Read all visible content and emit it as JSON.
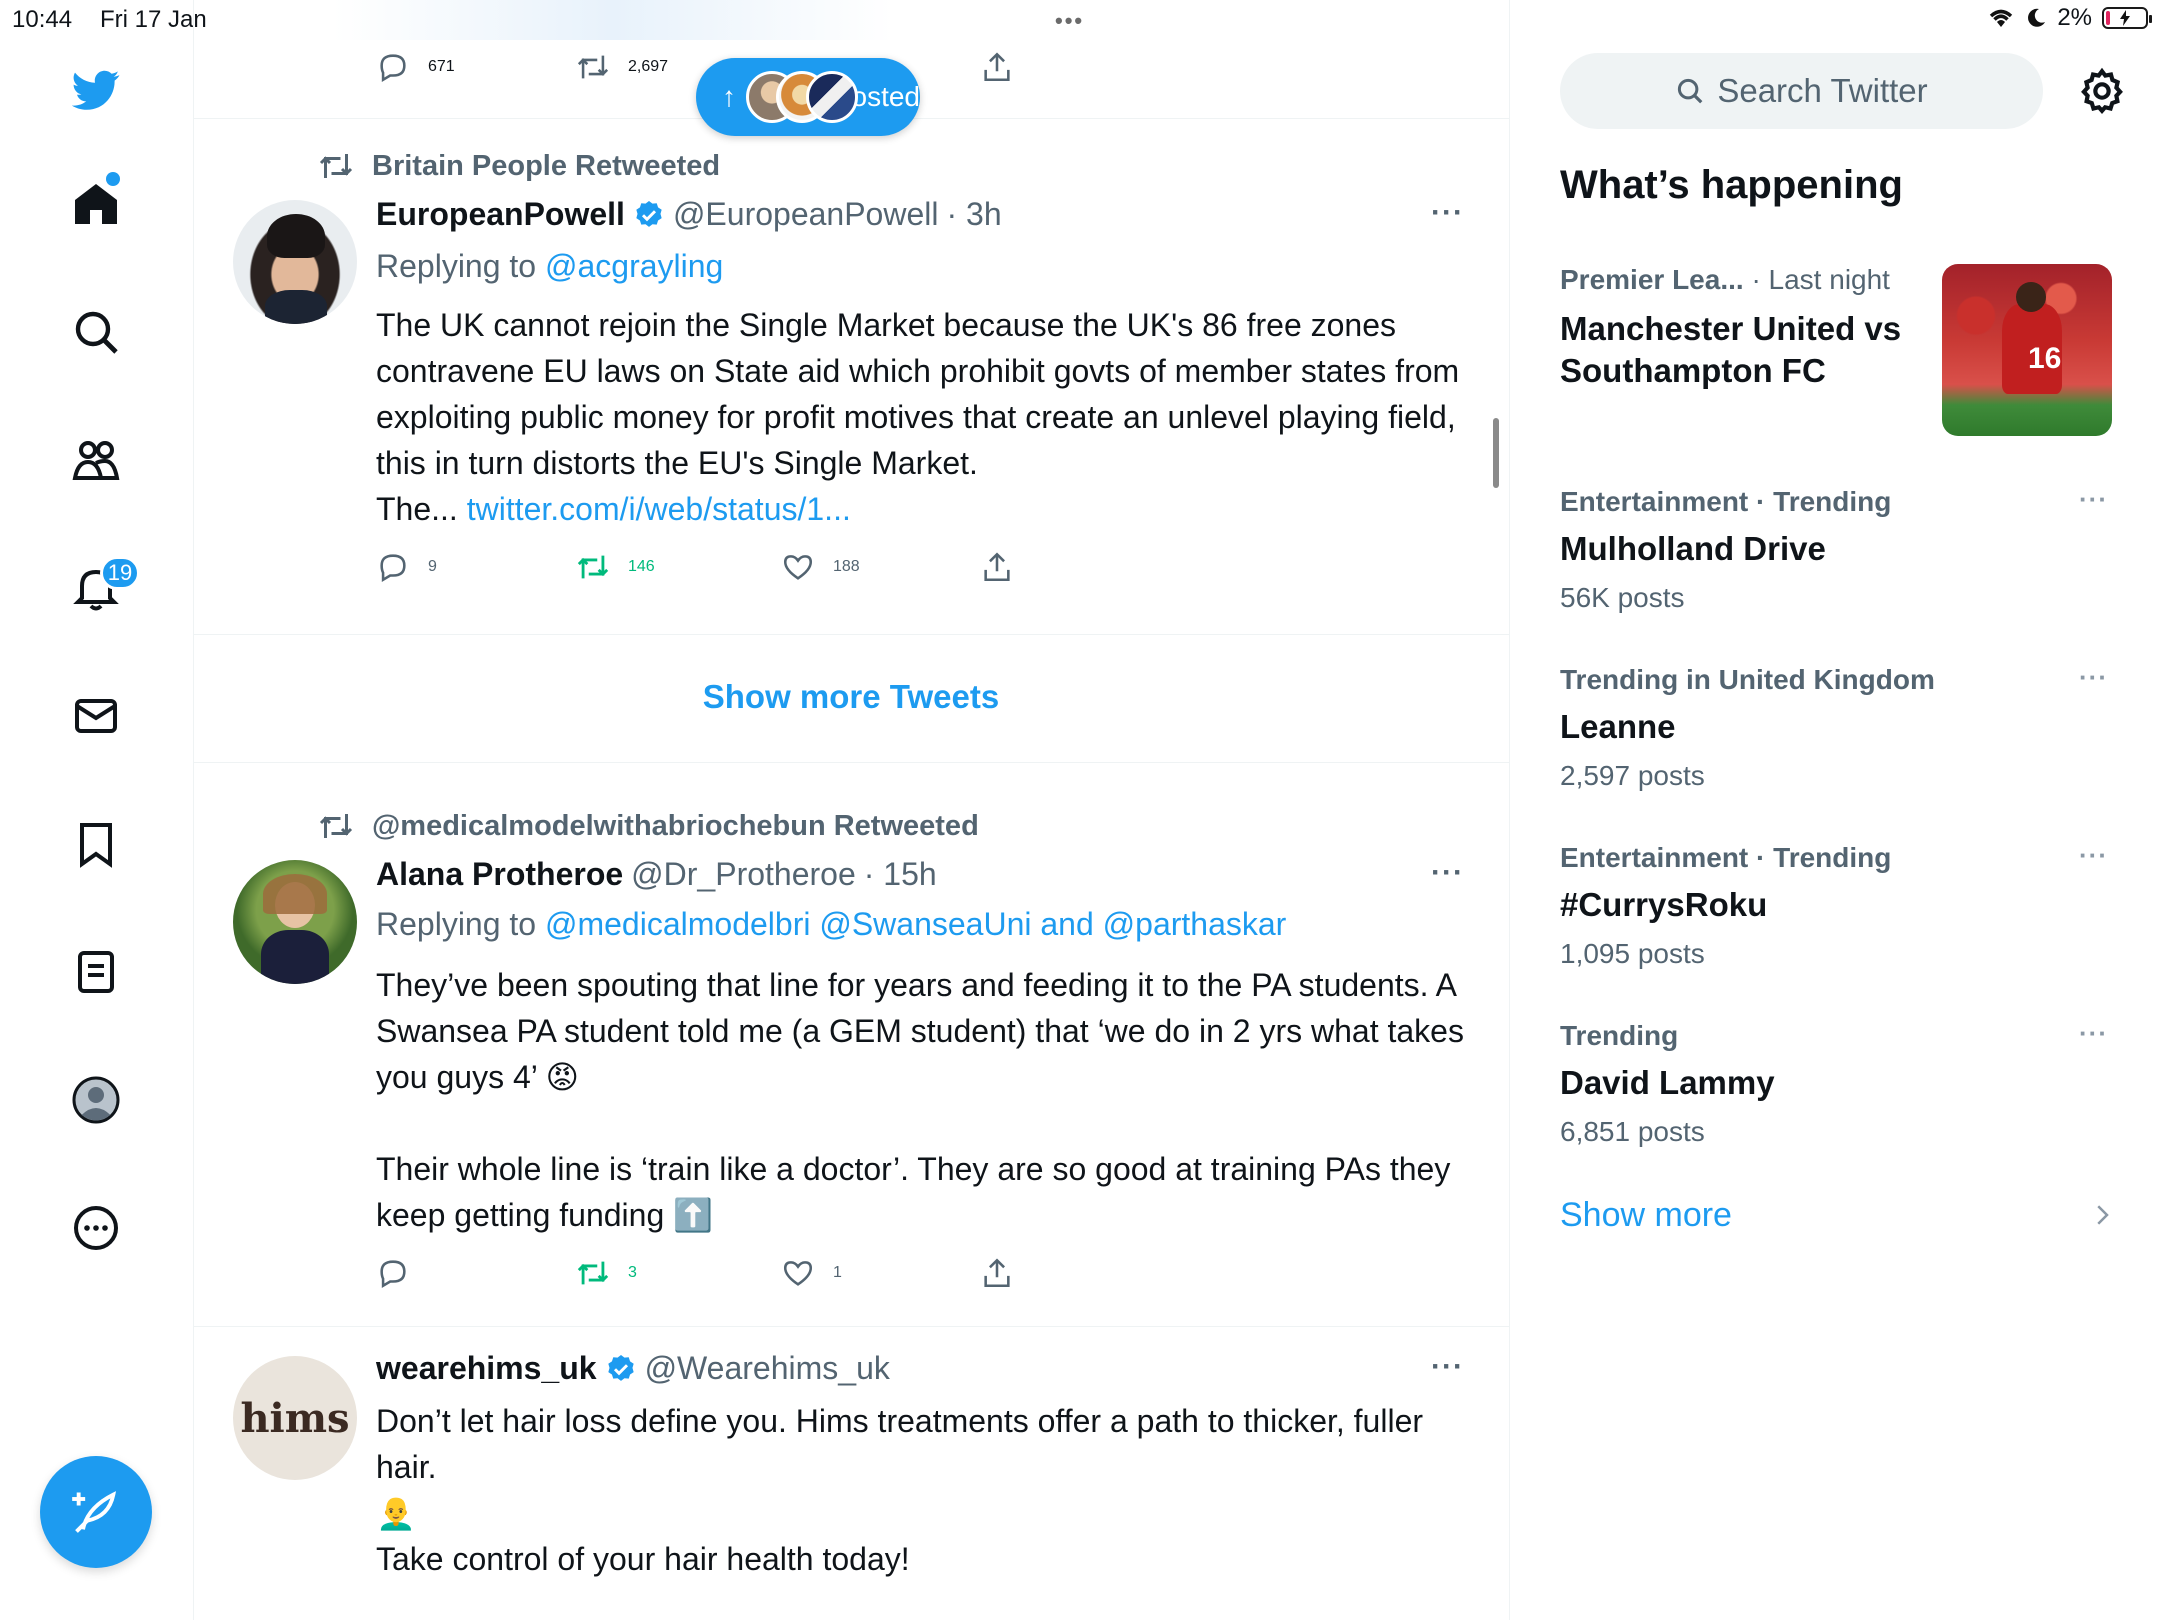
{
  "status_bar": {
    "time": "10:44",
    "date": "Fri 17 Jan",
    "battery": "2%"
  },
  "nav": {
    "notifications_badge": "19"
  },
  "posted_pill": {
    "label": "posted"
  },
  "top_tweet_actions": {
    "replies": "671",
    "retweets": "2,697"
  },
  "tweets": [
    {
      "context": "Britain People Retweeted",
      "name": "EuropeanPowell",
      "verified": true,
      "handle": "@EuropeanPowell",
      "time": "· 3h",
      "replying_prefix": "Replying to",
      "replying_to": "@acgrayling",
      "text": "The UK cannot rejoin the Single Market because the UK's 86 free zones contravene EU laws on State aid which prohibit govts of member states from exploiting public money for profit motives that create an unlevel playing field, this in turn distorts the EU's Single Market.\nThe... ",
      "link": "twitter.com/i/web/status/1...",
      "replies": "9",
      "retweets": "146",
      "likes": "188"
    },
    {
      "context": "@medicalmodelwithabriochebun Retweeted",
      "name": "Alana Protheroe",
      "verified": false,
      "handle": "@Dr_Protheroe",
      "time": "· 15h",
      "replying_prefix": "Replying to",
      "replying_to": "@medicalmodelbri @SwanseaUni and @parthaskar",
      "text": "They’ve been spouting that line for years and feeding it to the PA students. A Swansea PA student told me (a GEM student) that ‘we do in 2 yrs what takes you guys 4’ 😡\n\nTheir whole line is ‘train like a doctor’. They are so good at training PAs they keep getting funding ⬆️",
      "replies": "",
      "retweets": "3",
      "likes": "1"
    },
    {
      "name": "wearehims_uk",
      "verified": true,
      "handle": "@Wearehims_uk",
      "avatar_text": "hims",
      "text": "Don’t let hair loss define you. Hims treatments offer a path to thicker, fuller hair.\n👨‍🦲\nTake control of your hair health today!"
    }
  ],
  "show_more_tweets": "Show more Tweets",
  "sidebar": {
    "search_placeholder": "Search Twitter",
    "title": "What’s happening",
    "trends": [
      {
        "category": "Premier Lea...",
        "extra": "· Last night",
        "name": "Manchester United vs Southampton FC",
        "count": ""
      },
      {
        "category": "Entertainment · Trending",
        "name": "Mulholland Drive",
        "count": "56K posts"
      },
      {
        "category": "Trending in United Kingdom",
        "name": "Leanne",
        "count": "2,597 posts"
      },
      {
        "category": "Entertainment · Trending",
        "name": "#CurrysRoku",
        "count": "1,095 posts"
      },
      {
        "category": "Trending",
        "name": "David Lammy",
        "count": "6,851 posts"
      }
    ],
    "show_more": "Show more"
  },
  "colors": {
    "accent": "#1d9bf0",
    "retweet_green": "#00ba7c",
    "muted": "#536471"
  }
}
